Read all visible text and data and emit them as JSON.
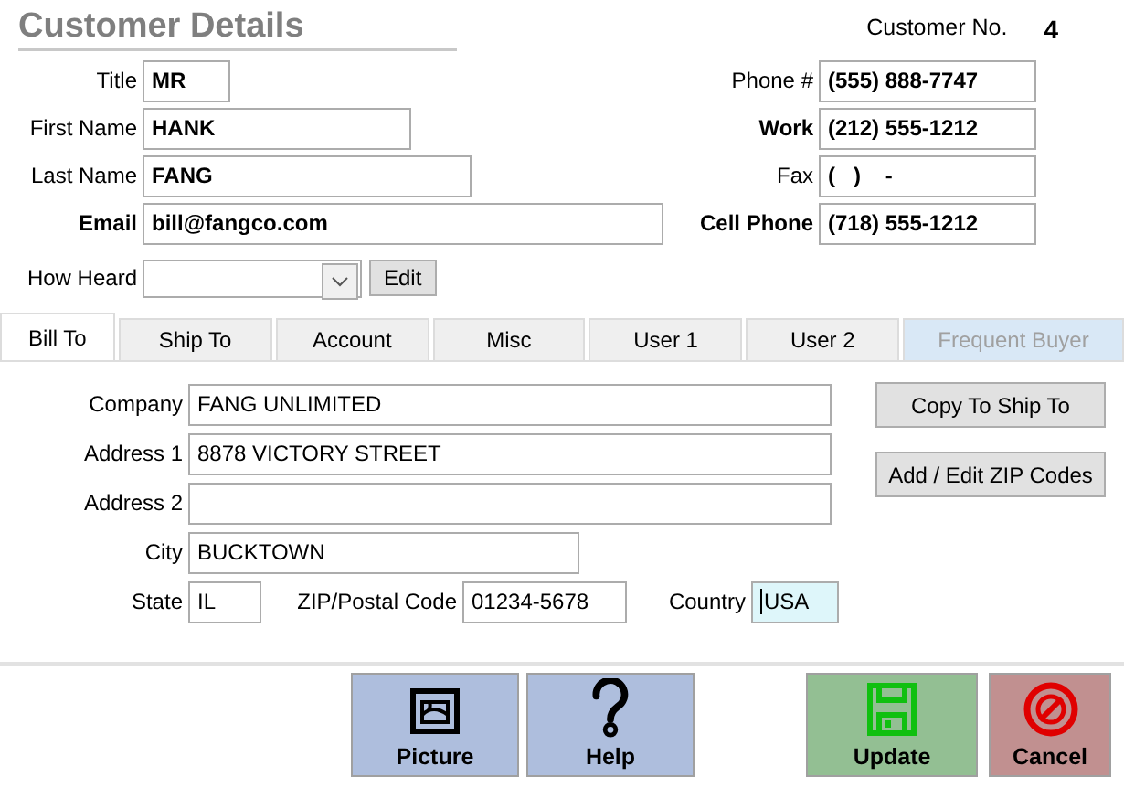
{
  "title": "Customer Details",
  "customer_no": {
    "label": "Customer No.",
    "value": "4"
  },
  "contact_fields": [
    {
      "label": "Title",
      "value": "MR",
      "emphasized": false
    },
    {
      "label": "First Name",
      "value": "HANK",
      "emphasized": false
    },
    {
      "label": "Last Name",
      "value": "FANG",
      "emphasized": false
    },
    {
      "label": "Email",
      "value": "bill@fangco.com",
      "emphasized": true
    }
  ],
  "how_heard": {
    "label": "How Heard",
    "button": "Edit"
  },
  "phone_fields": [
    {
      "label": "Phone #",
      "value": "(555) 888-7747",
      "emphasized": false
    },
    {
      "label": "Work",
      "value": "(212) 555-1212",
      "emphasized": true
    },
    {
      "label": "Fax",
      "value": "(   )    -",
      "emphasized": false
    },
    {
      "label": "Cell Phone",
      "value": "(718) 555-1212",
      "emphasized": true
    }
  ],
  "tabs": [
    {
      "label": "Bill To",
      "selected": true,
      "disabled": false
    },
    {
      "label": "Ship To",
      "selected": false,
      "disabled": false
    },
    {
      "label": "Account",
      "selected": false,
      "disabled": false
    },
    {
      "label": "Misc",
      "selected": false,
      "disabled": false
    },
    {
      "label": "User 1",
      "selected": false,
      "disabled": false
    },
    {
      "label": "User 2",
      "selected": false,
      "disabled": false
    },
    {
      "label": "Frequent Buyer",
      "selected": false,
      "disabled": true
    }
  ],
  "address_fields": [
    {
      "label": "Company",
      "value": "FANG UNLIMITED"
    },
    {
      "label": "Address 1",
      "value": "8878 VICTORY STREET"
    },
    {
      "label": "Address 2"
    },
    {
      "label": "City",
      "value": "BUCKTOWN"
    }
  ],
  "location_fields": [
    {
      "label": "State",
      "value": "IL",
      "focused": false
    },
    {
      "label": "ZIP/Postal Code",
      "value": "01234-5678",
      "focused": false
    },
    {
      "label": "Country",
      "value": "USA",
      "focused": true
    }
  ],
  "side_buttons": [
    "Copy To Ship To",
    "Add / Edit ZIP Codes"
  ],
  "bottom_buttons": [
    {
      "label": "Picture",
      "kind": "picture"
    },
    {
      "label": "Help",
      "kind": "help"
    },
    {
      "label": "Update",
      "kind": "save"
    },
    {
      "label": "Cancel",
      "kind": "cancel"
    }
  ]
}
